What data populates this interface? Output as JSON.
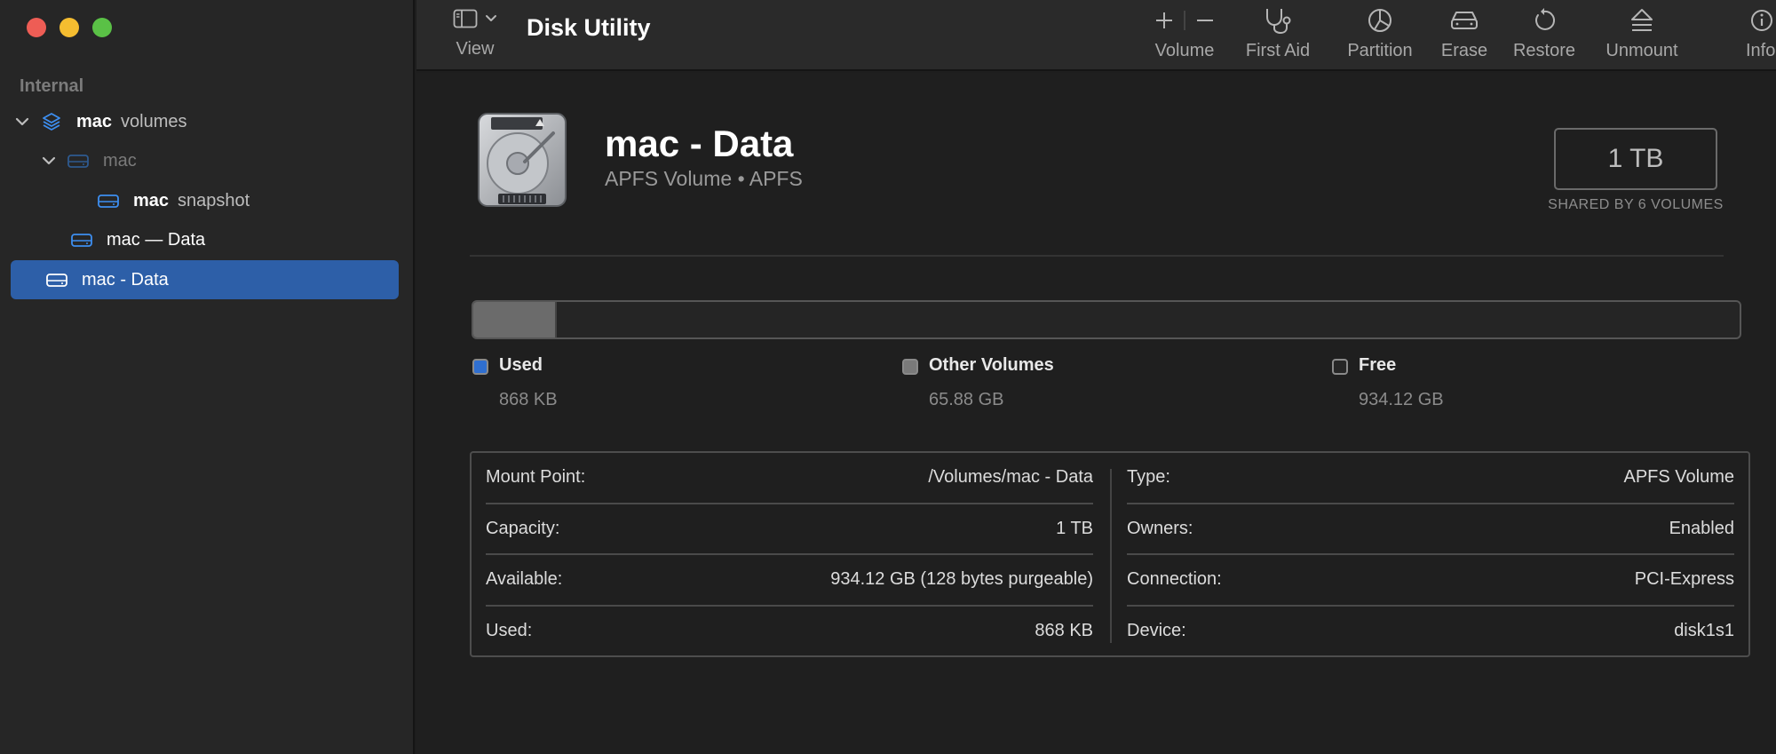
{
  "window": {
    "title": "Disk Utility"
  },
  "sidebar": {
    "section": "Internal",
    "items": [
      {
        "bold": "mac",
        "sub": "volumes"
      },
      {
        "bold": "",
        "sub": "mac"
      },
      {
        "bold": "mac",
        "sub": "snapshot"
      },
      {
        "bold": "mac — Data",
        "sub": ""
      },
      {
        "bold": "mac - Data",
        "sub": ""
      }
    ]
  },
  "toolbar": {
    "view_label": "View",
    "volume_label": "Volume",
    "first_aid_label": "First Aid",
    "partition_label": "Partition",
    "erase_label": "Erase",
    "restore_label": "Restore",
    "unmount_label": "Unmount",
    "info_label": "Info"
  },
  "volume": {
    "name": "mac - Data",
    "subtitle": "APFS Volume • APFS",
    "capacity": "1 TB",
    "shared": "SHARED BY 6 VOLUMES"
  },
  "usage": {
    "used_fraction": 0.066,
    "legend": [
      {
        "label": "Used",
        "value": "868 KB",
        "color": "#2f6fd0"
      },
      {
        "label": "Other Volumes",
        "value": "65.88 GB",
        "color": "#7a7a7a"
      },
      {
        "label": "Free",
        "value": "934.12 GB",
        "color": "#262626"
      }
    ]
  },
  "info": {
    "left": [
      {
        "key": "Mount Point:",
        "value": "/Volumes/mac - Data"
      },
      {
        "key": "Capacity:",
        "value": "1 TB"
      },
      {
        "key": "Available:",
        "value": "934.12 GB (128 bytes purgeable)"
      },
      {
        "key": "Used:",
        "value": "868 KB"
      }
    ],
    "right": [
      {
        "key": "Type:",
        "value": "APFS Volume"
      },
      {
        "key": "Owners:",
        "value": "Enabled"
      },
      {
        "key": "Connection:",
        "value": "PCI-Express"
      },
      {
        "key": "Device:",
        "value": "disk1s1"
      }
    ]
  }
}
